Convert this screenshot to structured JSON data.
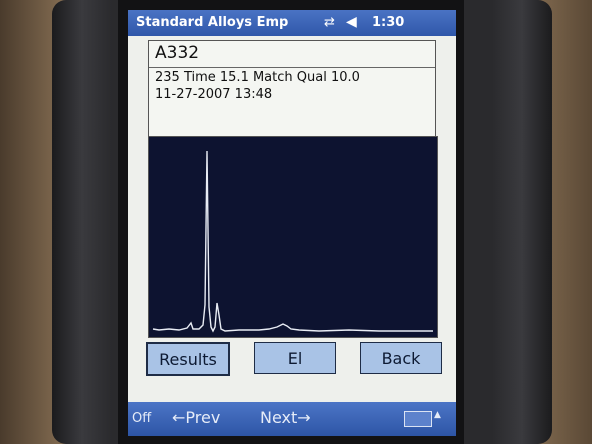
{
  "window": {
    "title": "Standard Alloys Emp",
    "time": "1:30"
  },
  "icons": {
    "connectivity": "connectivity-icon",
    "volume": "volume-icon",
    "keyboard": "keyboard-icon"
  },
  "result": {
    "alloy": "A332",
    "line1": "235 Time   15.1 Match Qual 10.0",
    "line2": "11-27-2007 13:48"
  },
  "buttons": {
    "results": "Results",
    "el": "El",
    "back": "Back"
  },
  "menubar": {
    "off": "Off",
    "prev": "←Prev",
    "next": "Next→"
  },
  "colors": {
    "titlebar": "#2f57aa",
    "button": "#a9c3e6",
    "spectrum_bg": "#0d1330",
    "trace": "#e8ecf4"
  }
}
